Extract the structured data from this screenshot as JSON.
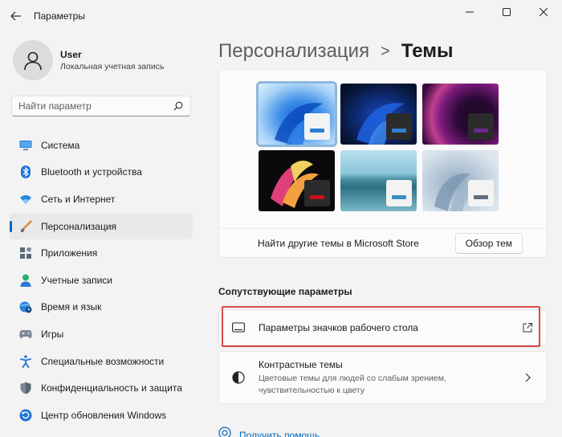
{
  "window": {
    "title": "Параметры",
    "back_icon": "arrow-left-icon",
    "controls": [
      "minimize-icon",
      "maximize-icon",
      "close-icon"
    ]
  },
  "profile": {
    "name": "User",
    "account_type": "Локальная учетная запись"
  },
  "search": {
    "placeholder": "Найти параметр",
    "icon": "search-icon"
  },
  "sidebar": {
    "active_index": 3,
    "items": [
      {
        "label": "Система",
        "icon": "monitor-icon"
      },
      {
        "label": "Bluetooth и устройства",
        "icon": "bluetooth-icon"
      },
      {
        "label": "Сеть и Интернет",
        "icon": "wifi-icon"
      },
      {
        "label": "Персонализация",
        "icon": "brush-icon"
      },
      {
        "label": "Приложения",
        "icon": "apps-icon"
      },
      {
        "label": "Учетные записи",
        "icon": "person-icon"
      },
      {
        "label": "Время и язык",
        "icon": "globe-clock-icon"
      },
      {
        "label": "Игры",
        "icon": "gamepad-icon"
      },
      {
        "label": "Специальные возможности",
        "icon": "accessibility-icon"
      },
      {
        "label": "Конфиденциальность и защита",
        "icon": "shield-icon"
      },
      {
        "label": "Центр обновления Windows",
        "icon": "update-icon"
      }
    ]
  },
  "breadcrumb": {
    "parent": "Персонализация",
    "separator": ">",
    "current": "Темы"
  },
  "themes": {
    "selected_index": 0,
    "tiles": [
      {
        "name": "windows-light",
        "accent": "#2f7fd0"
      },
      {
        "name": "windows-dark",
        "accent": "#2f7fd0"
      },
      {
        "name": "glow",
        "accent": "#6b2a8c"
      },
      {
        "name": "captured-motion",
        "accent": "#c8101e"
      },
      {
        "name": "sunrise",
        "accent": "#3b8fc4"
      },
      {
        "name": "flow",
        "accent": "#5f6f7f"
      }
    ],
    "store_text": "Найти другие темы в Microsoft Store",
    "browse_button": "Обзор тем"
  },
  "related": {
    "title": "Сопутствующие параметры",
    "items": [
      {
        "title": "Параметры значков рабочего стола",
        "description": "",
        "icon": "desktop-icon",
        "action": "external-link-icon"
      },
      {
        "title": "Контрастные темы",
        "description": "Цветовые темы для людей со слабым зрением, чувствительностью к цвету",
        "icon": "contrast-icon",
        "action": "chevron-right-icon"
      }
    ]
  },
  "help": {
    "label": "Получить помощь",
    "icon": "help-icon"
  },
  "colors": {
    "accent": "#0067c0",
    "highlight": "#d84a4a"
  }
}
